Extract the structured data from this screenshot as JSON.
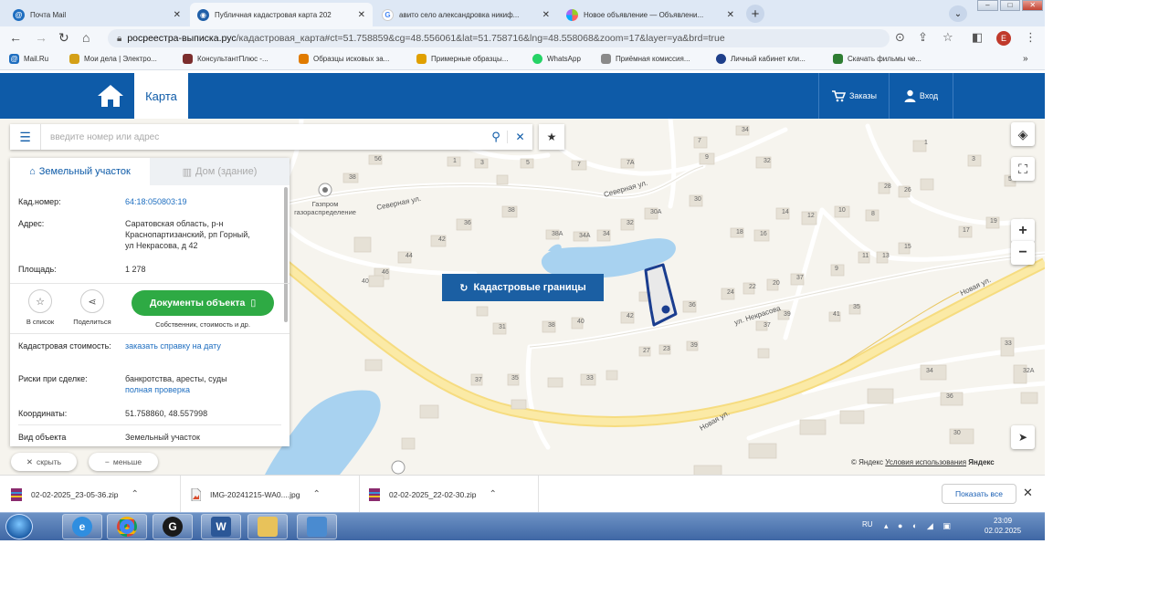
{
  "browser": {
    "tabs": [
      {
        "title": "Почта Mail",
        "favicon": "mail-icon",
        "active": false
      },
      {
        "title": "Публичная кадастровая карта 202",
        "favicon": "cadastre-icon",
        "active": true
      },
      {
        "title": "авито село александровка никиф...",
        "favicon": "google-icon",
        "active": false
      },
      {
        "title": "Новое объявление — Объявлени...",
        "favicon": "avito-icon",
        "active": false
      }
    ],
    "url_domain": "росреестра-выписка.рус",
    "url_path": "/кадастровая_карта#ct=51.758859&cg=48.556061&lat=51.758716&lng=48.558068&zoom=17&layer=ya&brd=true",
    "profile_initial": "Е",
    "bookmarks": [
      {
        "label": "Mail.Ru",
        "icon": "mailru-icon"
      },
      {
        "label": "Мои дела | Электро...",
        "icon": "folder-icon"
      },
      {
        "label": "КонсультантПлюс -...",
        "icon": "consultant-icon"
      },
      {
        "label": "Образцы исковых за...",
        "icon": "document-icon"
      },
      {
        "label": "Примерные образцы...",
        "icon": "document-icon"
      },
      {
        "label": "WhatsApp",
        "icon": "whatsapp-icon"
      },
      {
        "label": "Приёмная комиссия...",
        "icon": "building-icon"
      },
      {
        "label": "Личный кабинет кли...",
        "icon": "globe-icon"
      },
      {
        "label": "Скачать фильмы че...",
        "icon": "film-icon"
      }
    ],
    "bookmarks_overflow": "»"
  },
  "site": {
    "tab_map": "Карта",
    "orders": "Заказы",
    "login": "Вход"
  },
  "map": {
    "search_placeholder": "введите номер или адрес",
    "cadastral_button": "Кадастровые границы",
    "copyright_prefix": "© Яндекс",
    "copyright_link": "Условия использования",
    "copyright_brand": "Яндекс",
    "building_numbers": [
      "56",
      "1",
      "3",
      "5",
      "7",
      "7А",
      "9",
      "34",
      "32",
      "38",
      "36",
      "42",
      "44",
      "46",
      "40",
      "38",
      "38А",
      "34А",
      "34",
      "32",
      "30А",
      "30",
      "18",
      "16",
      "14",
      "12",
      "10",
      "8",
      "28",
      "26",
      "24",
      "22",
      "20",
      "37",
      "36",
      "42",
      "40",
      "38",
      "31",
      "27",
      "23",
      "39",
      "37",
      "35",
      "33",
      "1",
      "3",
      "5",
      "7",
      "9",
      "11",
      "13",
      "15",
      "17",
      "19",
      "37",
      "39",
      "41",
      "35",
      "34",
      "36",
      "30",
      "32А",
      "33"
    ],
    "street_labels": [
      "Северная ул.",
      "Северная ул.",
      "ул. Некрасова",
      "Новая ул.",
      "Новая ул."
    ],
    "poi_label": "Газпром газораспределение",
    "zoom_in": "+",
    "zoom_out": "−"
  },
  "panel": {
    "tab_land": "Земельный участок",
    "tab_building": "Дом (здание)",
    "fields": [
      {
        "key": "Кад.номер:",
        "value": "64:18:050803:19",
        "link": true
      },
      {
        "key": "Адрес:",
        "value": "Саратовская область, р-н Краснопартизанский, рп Горный, ул Некрасова, д 42",
        "link": false
      },
      {
        "key": "Площадь:",
        "value": "1 278",
        "link": false
      }
    ],
    "actions": {
      "add_list": "В список",
      "share": "Поделиться",
      "documents": "Документы объекта",
      "documents_sub": "Собственник, стоимость и др."
    },
    "fields2": [
      {
        "key": "Кадастровая стоимость:",
        "value": "заказать справку на дату",
        "link": true
      },
      {
        "key": "Риски при сделке:",
        "value": "банкротства, аресты, суды",
        "link": false,
        "extra": "полная проверка"
      },
      {
        "key": "Координаты:",
        "value": "51.758860, 48.557998",
        "link": false
      },
      {
        "key": "Вид объекта",
        "value": "Земельный участок",
        "link": false
      }
    ],
    "hide_btn": "скрыть",
    "less_btn": "меньше"
  },
  "downloads": {
    "items": [
      {
        "name": "02-02-2025_23-05-36.zip",
        "icon": "archive-icon"
      },
      {
        "name": "IMG-20241215-WA0....jpg",
        "icon": "image-icon"
      },
      {
        "name": "02-02-2025_22-02-30.zip",
        "icon": "archive-icon"
      }
    ],
    "show_all": "Показать все"
  },
  "taskbar": {
    "apps": [
      "ie-icon",
      "chrome-icon",
      "opera-icon",
      "word-icon",
      "explorer-icon",
      "network-icon"
    ],
    "language": "RU",
    "time": "23:09",
    "date": "02.02.2025"
  }
}
